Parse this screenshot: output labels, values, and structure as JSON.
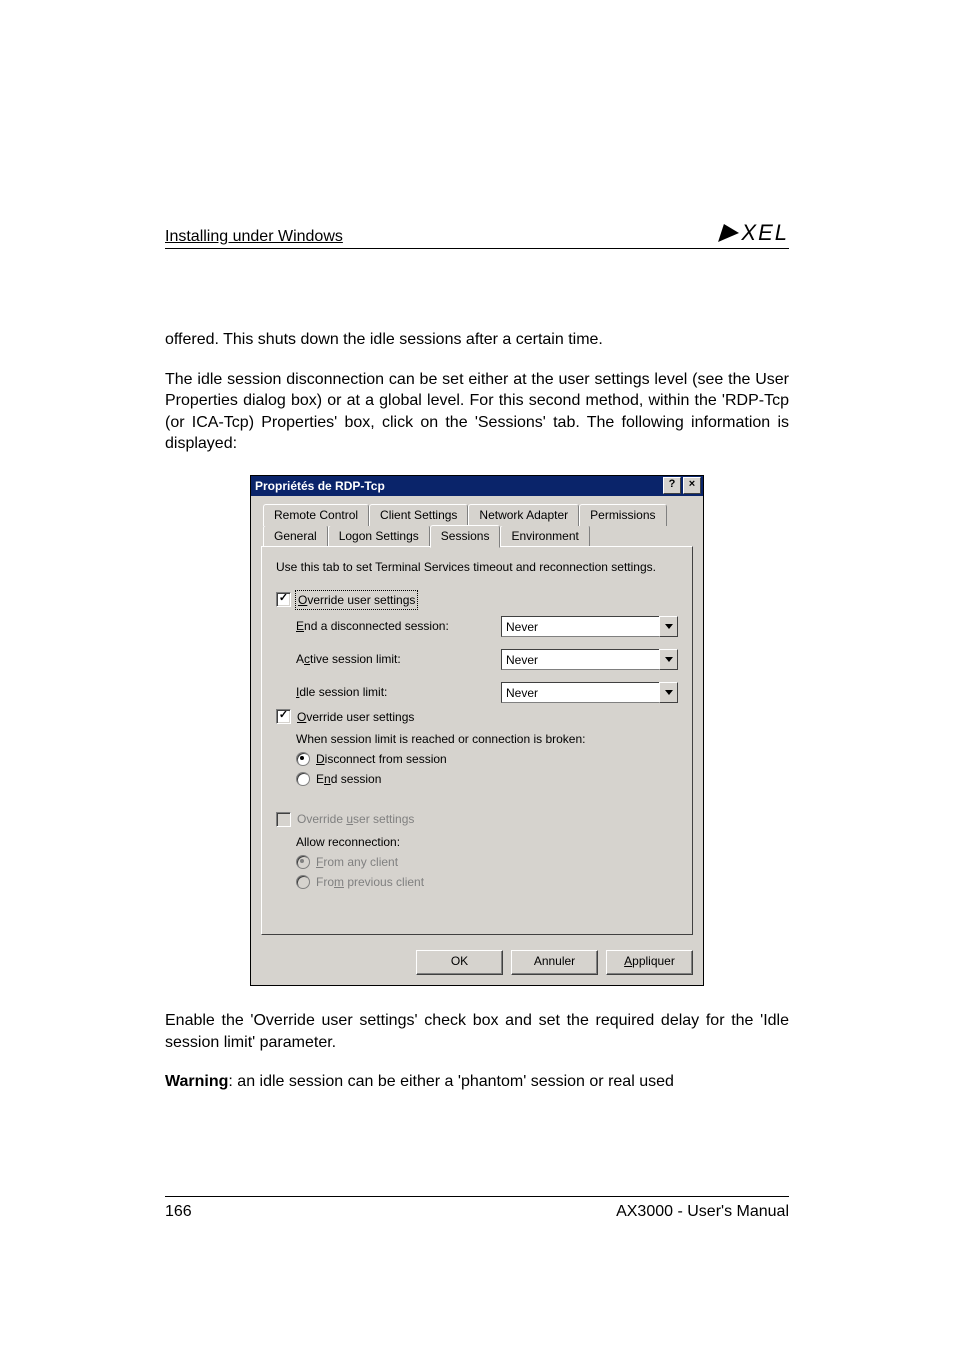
{
  "header": {
    "title": "Installing under Windows",
    "logo_text": "XEL"
  },
  "paragraphs": {
    "p1": "offered. This shuts down the idle sessions after a certain time.",
    "p2": "The idle session disconnection can be set either at the user settings level (see the User Properties dialog box) or at a global level. For this second method, within the 'RDP-Tcp (or ICA-Tcp) Properties' box, click on the 'Sessions' tab. The following information is displayed:",
    "p3": "Enable the 'Override user settings' check box and set the required delay for the 'Idle session limit' parameter.",
    "p4_strong": "Warning",
    "p4_rest": ": an idle session can be either a 'phantom' session or real used"
  },
  "dialog": {
    "title": "Propriétés de RDP-Tcp",
    "help_glyph": "?",
    "close_glyph": "×",
    "tabs_row1": [
      "Remote Control",
      "Client Settings",
      "Network Adapter",
      "Permissions"
    ],
    "tabs_row2": [
      "General",
      "Logon Settings",
      "Sessions",
      "Environment"
    ],
    "active_tab_index_row2": 2,
    "intro": "Use this tab to set Terminal Services timeout and reconnection settings.",
    "group1": {
      "override_label_pre": "O",
      "override_label_rest": "verride user settings",
      "override_checked": true,
      "end_label_pre": "E",
      "end_label_rest": "nd a disconnected session:",
      "end_value": "Never",
      "active_label_pre": "c",
      "active_label_prefix": "A",
      "active_label_rest": "tive session limit:",
      "active_value": "Never",
      "idle_label_pre": "I",
      "idle_label_rest": "dle session limit:",
      "idle_value": "Never"
    },
    "group2": {
      "override_label_pre": "O",
      "override_label_rest": "verride user settings",
      "override_checked": true,
      "when_text": "When session limit is reached or connection is broken:",
      "radio_disconnect_pre": "D",
      "radio_disconnect_rest": "isconnect from session",
      "radio_end_pre": "n",
      "radio_end_prefix": "E",
      "radio_end_rest": "d session",
      "selected": "disconnect"
    },
    "group3": {
      "override_label_pre": "u",
      "override_label_prefix": "Override ",
      "override_label_rest": "ser settings",
      "override_checked": false,
      "allow_text": "Allow reconnection:",
      "radio_any_pre": "F",
      "radio_any_rest": "rom any client",
      "radio_prev_pre": "m",
      "radio_prev_prefix": "Fro",
      "radio_prev_rest": " previous client"
    },
    "buttons": {
      "ok": "OK",
      "cancel": "Annuler",
      "apply_pre": "A",
      "apply_rest": "ppliquer"
    }
  },
  "footer": {
    "page": "166",
    "manual": "AX3000 - User's Manual"
  }
}
